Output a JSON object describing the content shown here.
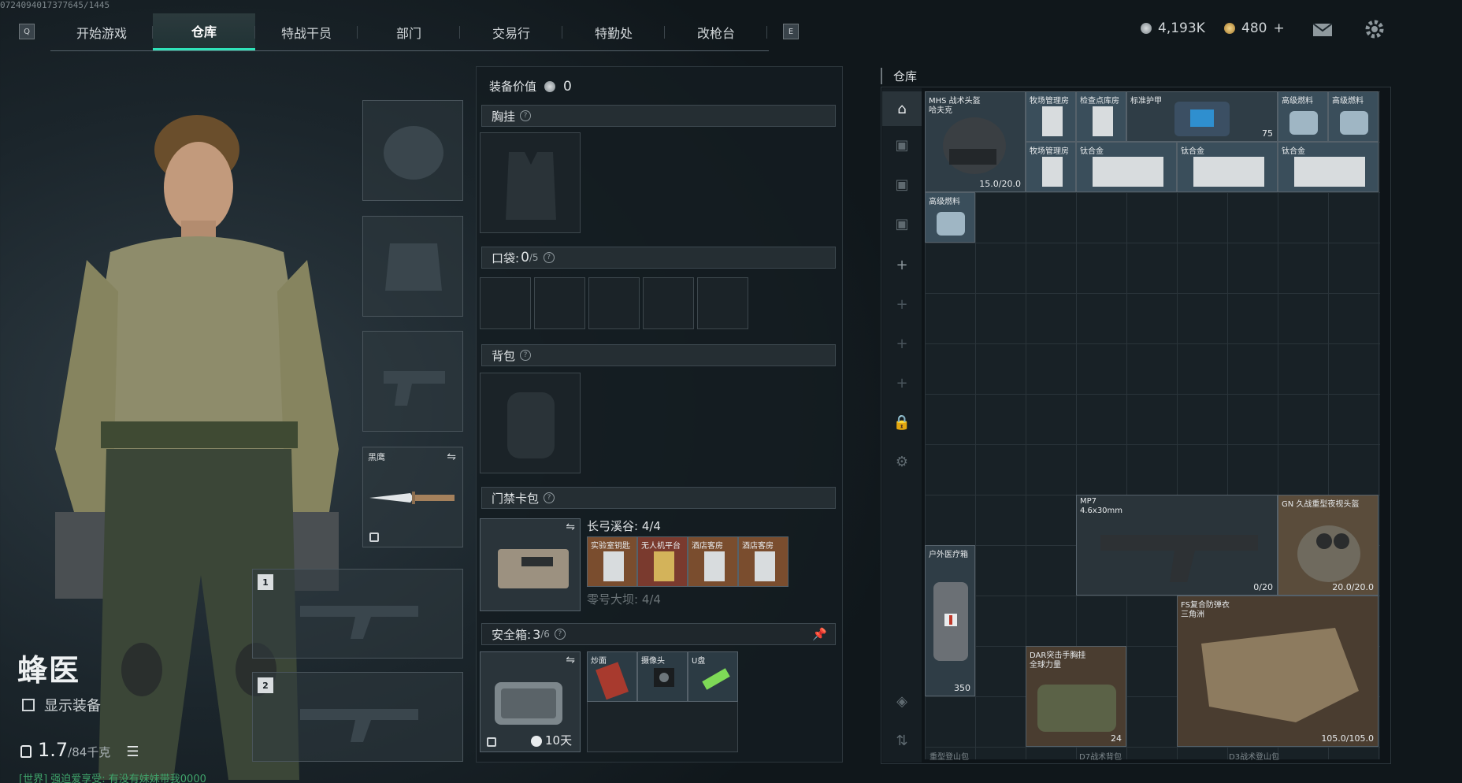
{
  "player_id": "0724094017377645/1445",
  "nav": {
    "left_key": "Q",
    "right_key": "E",
    "tabs": [
      {
        "label": "开始游戏"
      },
      {
        "label": "仓库"
      },
      {
        "label": "特战干员"
      },
      {
        "label": "部门"
      },
      {
        "label": "交易行"
      },
      {
        "label": "特勤处"
      },
      {
        "label": "改枪台"
      }
    ]
  },
  "currency": {
    "silver": "4,193K",
    "gold": "480",
    "gold_plus": "+"
  },
  "character": {
    "name": "蜂医",
    "show_equipment": "显示装备",
    "weight_main": "1.7",
    "weight_total": "/84千克",
    "chat": "[世界] 强迫爱享受: 有没有妹妹带我0000"
  },
  "equip_slots": {
    "melee_label": "黑鹰",
    "gun1": "1",
    "gun2": "2"
  },
  "loadout": {
    "value_label": "装备价值",
    "value": "0",
    "chest_rig": "胸挂",
    "pockets_label": "口袋:",
    "pockets_count": "0",
    "pockets_max": "/5",
    "backpack": "背包",
    "keycard": "门禁卡包",
    "key_map1": "长弓溪谷: 4/4",
    "key_map2": "零号大坝: 4/4",
    "keys": [
      "实验室钥匙",
      "无人机平台",
      "酒店客房",
      "酒店客房"
    ],
    "safebox_label": "安全箱:",
    "safebox_count": "3",
    "safebox_max": "/6",
    "safebox_time": "10天",
    "safebox_items": [
      "炒面",
      "摄像头",
      "U盘"
    ]
  },
  "warehouse": {
    "title": "仓库",
    "items": [
      {
        "id": "helmet",
        "label": "MHS 战术头盔",
        "sub": "哈夫克",
        "value": "15.0/20.0"
      },
      {
        "id": "key1",
        "label": "牧场管理房"
      },
      {
        "id": "key2",
        "label": "检查点库房"
      },
      {
        "id": "key3",
        "label": "牧场管理房"
      },
      {
        "id": "armor",
        "label": "标准护甲",
        "value": "75"
      },
      {
        "id": "fuel1",
        "label": "高级燃料"
      },
      {
        "id": "fuel2",
        "label": "高级燃料"
      },
      {
        "id": "alloy1",
        "label": "钛合金"
      },
      {
        "id": "alloy2",
        "label": "钛合金"
      },
      {
        "id": "alloy3",
        "label": "钛合金"
      },
      {
        "id": "fuel3",
        "label": "高级燃料"
      },
      {
        "id": "mp7",
        "label": "MP7",
        "sub": "4.6x30mm",
        "value": "0/20"
      },
      {
        "id": "nvg",
        "label": "GN 久战重型夜视头盔",
        "value": "20.0/20.0"
      },
      {
        "id": "medkit",
        "label": "户外医疗箱",
        "value": "350"
      },
      {
        "id": "vest",
        "label": "FS复合防弹衣",
        "sub": "三角洲",
        "value": "105.0/105.0"
      },
      {
        "id": "rig",
        "label": "DAR突击手胸挂",
        "sub": "全球力量",
        "value": "24"
      }
    ],
    "bottom_labels": [
      "重型登山包",
      "D7战术背包",
      "D3战术登山包"
    ]
  }
}
